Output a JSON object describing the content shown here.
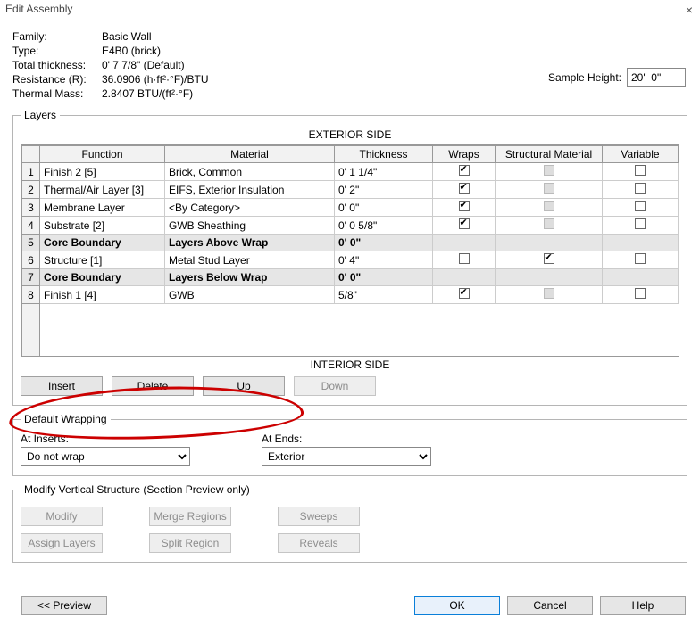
{
  "title": "Edit Assembly",
  "meta": {
    "family_label": "Family:",
    "family_value": "Basic Wall",
    "type_label": "Type:",
    "type_value": "E4B0 (brick)",
    "thickness_label": "Total thickness:",
    "thickness_value": "0'  7 7/8\" (Default)",
    "resistance_label": "Resistance (R):",
    "resistance_value": "36.0906 (h·ft²·°F)/BTU",
    "mass_label": "Thermal Mass:",
    "mass_value": "2.8407 BTU/(ft²·°F)",
    "sample_label": "Sample Height:",
    "sample_value": "20'  0\""
  },
  "layers": {
    "legend": "Layers",
    "exterior": "EXTERIOR SIDE",
    "interior": "INTERIOR SIDE",
    "headers": {
      "function": "Function",
      "material": "Material",
      "thickness": "Thickness",
      "wraps": "Wraps",
      "structural": "Structural Material",
      "variable": "Variable"
    },
    "rows": [
      {
        "n": "1",
        "fn": "Finish 2 [5]",
        "mat": "Brick, Common",
        "th": "0'  1 1/4\"",
        "wraps": true,
        "sm": false,
        "var": false,
        "core": false
      },
      {
        "n": "2",
        "fn": "Thermal/Air Layer [3]",
        "mat": "EIFS, Exterior Insulation",
        "th": "0'  2\"",
        "wraps": true,
        "sm": false,
        "var": false,
        "core": false
      },
      {
        "n": "3",
        "fn": "Membrane Layer",
        "mat": "<By Category>",
        "th": "0'  0\"",
        "wraps": true,
        "sm": false,
        "var": false,
        "core": false
      },
      {
        "n": "4",
        "fn": "Substrate [2]",
        "mat": "GWB Sheathing",
        "th": "0'  0 5/8\"",
        "wraps": true,
        "sm": false,
        "var": false,
        "core": false
      },
      {
        "n": "5",
        "fn": "Core Boundary",
        "mat": "Layers Above Wrap",
        "th": "0'  0\"",
        "wraps": null,
        "sm": null,
        "var": null,
        "core": true
      },
      {
        "n": "6",
        "fn": "Structure [1]",
        "mat": "Metal Stud Layer",
        "th": "0'  4\"",
        "wraps": false,
        "sm": true,
        "var": false,
        "core": false
      },
      {
        "n": "7",
        "fn": "Core Boundary",
        "mat": "Layers Below Wrap",
        "th": "0'  0\"",
        "wraps": null,
        "sm": null,
        "var": null,
        "core": true
      },
      {
        "n": "8",
        "fn": "Finish 1 [4]",
        "mat": "GWB",
        "th": "5/8\"",
        "wraps": true,
        "sm": false,
        "var": false,
        "core": false
      }
    ],
    "buttons": {
      "insert": "Insert",
      "delete": "Delete",
      "up": "Up",
      "down": "Down"
    }
  },
  "wrapping": {
    "legend": "Default Wrapping",
    "inserts_label": "At Inserts:",
    "inserts_value": "Do not wrap",
    "ends_label": "At Ends:",
    "ends_value": "Exterior"
  },
  "modify": {
    "legend": "Modify Vertical Structure (Section Preview only)",
    "buttons": {
      "modify": "Modify",
      "merge": "Merge Regions",
      "sweeps": "Sweeps",
      "assign": "Assign Layers",
      "split": "Split Region",
      "reveals": "Reveals"
    }
  },
  "footer": {
    "preview": "<< Preview",
    "ok": "OK",
    "cancel": "Cancel",
    "help": "Help"
  }
}
